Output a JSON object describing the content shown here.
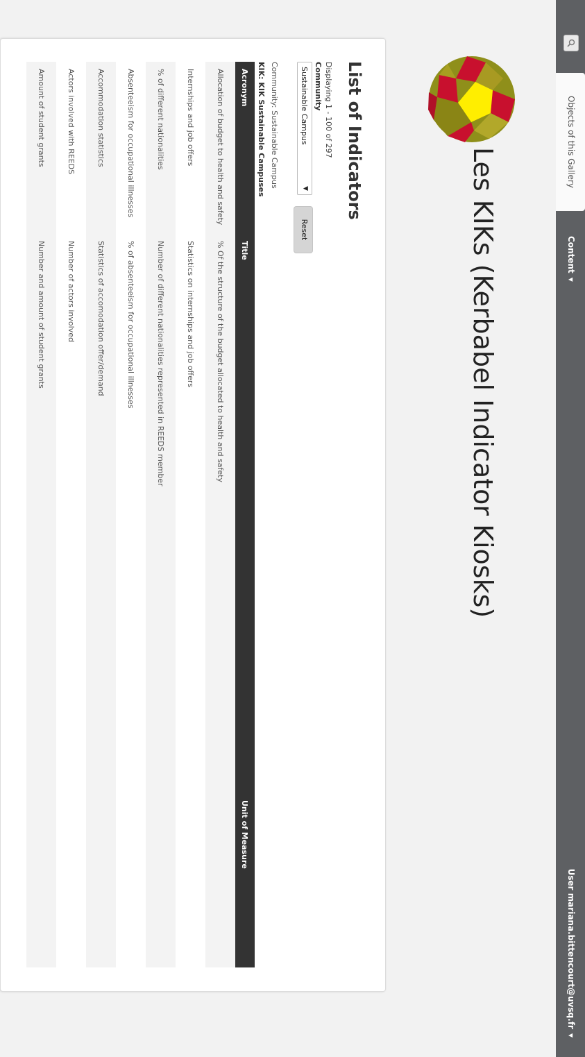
{
  "topbar": {
    "search_icon": "search-icon",
    "gallery_tab": "Objects of this Gallery",
    "content_menu": "Content",
    "user_menu": "User mariana.bittencourt@uvsq.fr"
  },
  "site": {
    "title": "Les KIKs (Kerbabel Indicator Kiosks)",
    "logo_icon": "polyhedron-logo"
  },
  "list": {
    "heading": "List of Indicators",
    "displaying": "Displaying 1 - 100 of 297",
    "community_label": "Community",
    "community_selected": "Sustainable Campus",
    "reset_label": "Reset",
    "active_filter": "Community: Sustainable Campus",
    "kik_name": "KIK: KIK Sustainable Campuses"
  },
  "table": {
    "headers": [
      "Acronym",
      "Title",
      "Unit of Measure"
    ],
    "rows": [
      {
        "acronym": "Allocation of budget to health and safety",
        "title": "% Of the structure of the budget allocated to health and safety",
        "unit": ""
      },
      {
        "acronym": "Internships and job offers",
        "title": "Statistics on internships and job offers",
        "unit": ""
      },
      {
        "acronym": "% of different nationalities",
        "title": "Number of different nationalities represented in REEDS member",
        "unit": ""
      },
      {
        "acronym": "Absenteeism for occupational illnesses",
        "title": "% of absenteeism for occupational illnesses",
        "unit": ""
      },
      {
        "acronym": "Accommodation statistics",
        "title": "Statistics of accomodation offer/demand",
        "unit": ""
      },
      {
        "acronym": "Actors involved with REEDS",
        "title": "Number of actors involved",
        "unit": ""
      },
      {
        "acronym": "Amount of student grants",
        "title": "Number and amount of student grants",
        "unit": ""
      }
    ]
  },
  "colors": {
    "topbar": "#5e6063",
    "table_header": "#333333",
    "logo_red": "#c8102e",
    "logo_olive": "#8f8f1a",
    "logo_yellow": "#ffee00"
  }
}
